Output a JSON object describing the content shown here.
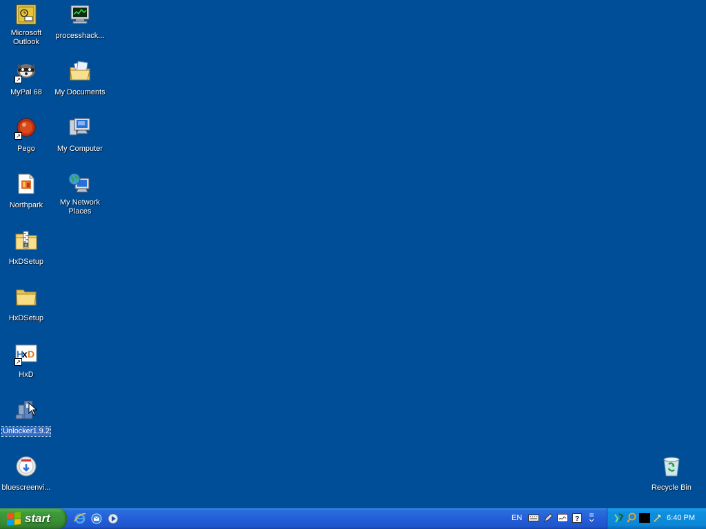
{
  "desktop": {
    "icons": [
      {
        "label": "Microsoft Outlook",
        "icon": "outlook-icon"
      },
      {
        "label": "processhack...",
        "icon": "process-hacker-icon"
      },
      {
        "label": "MyPal 68",
        "icon": "mypal-icon"
      },
      {
        "label": "My Documents",
        "icon": "my-documents-icon"
      },
      {
        "label": "Pego",
        "icon": "pego-icon"
      },
      {
        "label": "My Computer",
        "icon": "my-computer-icon"
      },
      {
        "label": "Northpark",
        "icon": "northpark-icon"
      },
      {
        "label": "My Network Places",
        "icon": "network-places-icon"
      },
      {
        "label": "HxDSetup",
        "icon": "zip-folder-icon"
      },
      {
        "label": "HxDSetup",
        "icon": "folder-icon"
      },
      {
        "label": "HxD",
        "icon": "hxd-icon"
      },
      {
        "label": "Unlocker1.9.2",
        "icon": "unlocker-installer-icon"
      },
      {
        "label": "bluescreenvi...",
        "icon": "bluescreenview-icon"
      },
      {
        "label": "Recycle Bin",
        "icon": "recycle-bin-icon"
      }
    ]
  },
  "taskbar": {
    "start_label": "start",
    "quick_launch": [
      "internet-explorer-icon",
      "outlook-express-icon",
      "media-player-icon"
    ],
    "language": "EN",
    "tray_tools": [
      "keyboard-icon",
      "pen-icon",
      "handwriting-icon",
      "help-icon",
      "options-icon"
    ],
    "tray_icons": [
      "network-icon",
      "search-icon",
      "terminal-icon",
      "cleanup-icon"
    ],
    "clock": "6:40 PM"
  },
  "colors": {
    "desktop_bg": "#004e98",
    "taskbar": "#245edb",
    "start_button": "#3a8f36",
    "tray": "#0c86d6"
  }
}
